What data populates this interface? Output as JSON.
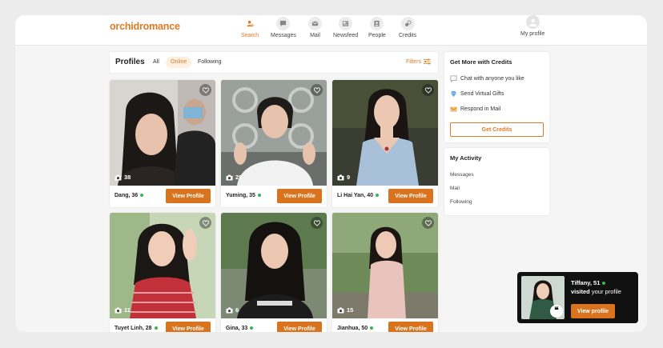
{
  "brand": {
    "logo_text": "orchidromance",
    "accent": "#e07b24"
  },
  "nav": {
    "items": [
      {
        "key": "search",
        "label": "Search",
        "icon": "search-users-icon",
        "active": true
      },
      {
        "key": "messages",
        "label": "Messages",
        "icon": "chat-icon"
      },
      {
        "key": "mail",
        "label": "Mail",
        "icon": "mail-icon"
      },
      {
        "key": "newsfeed",
        "label": "Newsfeed",
        "icon": "newsfeed-icon"
      },
      {
        "key": "people",
        "label": "People",
        "icon": "people-icon"
      },
      {
        "key": "credits",
        "label": "Credits",
        "icon": "credits-icon"
      }
    ],
    "profile_label": "My profile"
  },
  "profiles_header": {
    "title": "Profiles",
    "tabs": [
      "All",
      "Online",
      "Following"
    ],
    "active_tab": "Online",
    "filters_label": "Filters"
  },
  "profiles": [
    {
      "name": "Dang, 36",
      "photos": "38",
      "online": true,
      "button": "View Profile"
    },
    {
      "name": "Yuming, 35",
      "photos": "29",
      "online": true,
      "button": "View Profile"
    },
    {
      "name": "Li Hai Yan, 40",
      "photos": "9",
      "online": true,
      "button": "View Profile"
    },
    {
      "name": "Tuyet Linh, 28",
      "photos": "11",
      "online": true,
      "button": "View Profile"
    },
    {
      "name": "Gina, 33",
      "photos": "6",
      "online": true,
      "button": "View Profile"
    },
    {
      "name": "Jianhua, 50",
      "photos": "15",
      "online": true,
      "button": "View Profile"
    }
  ],
  "credits_panel": {
    "title": "Get More with Credits",
    "items": [
      {
        "label": "Chat with anyone you like",
        "icon": "chat-bubble-icon"
      },
      {
        "label": "Send Virtual Gifts",
        "icon": "diamond-icon"
      },
      {
        "label": "Respond in Mail",
        "icon": "envelope-icon"
      }
    ],
    "button": "Get Credits"
  },
  "activity_panel": {
    "title": "My Activity",
    "items": [
      "Messages",
      "Mail",
      "Following"
    ]
  },
  "toast": {
    "name": "Tiffany, 51",
    "verb": "visited",
    "rest": " your profile",
    "button": "View profile"
  }
}
